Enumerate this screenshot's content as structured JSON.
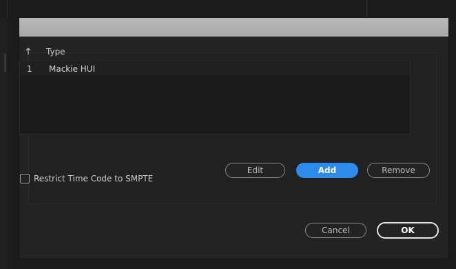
{
  "dialog": {
    "title": ""
  },
  "list": {
    "sort_icon": "sort-arrow-up-icon",
    "header_type": "Type",
    "rows": [
      {
        "index": "1",
        "type": "Mackie HUI"
      }
    ]
  },
  "buttons": {
    "edit": "Edit",
    "add": "Add",
    "remove": "Remove",
    "cancel": "Cancel",
    "ok": "OK"
  },
  "options": {
    "restrict_label": "Restrict Time Code to SMPTE",
    "restrict_checked": false
  },
  "colors": {
    "accent": "#2d8ceb",
    "dialog_bg": "#232323",
    "titlebar": "#b1b1b1"
  }
}
